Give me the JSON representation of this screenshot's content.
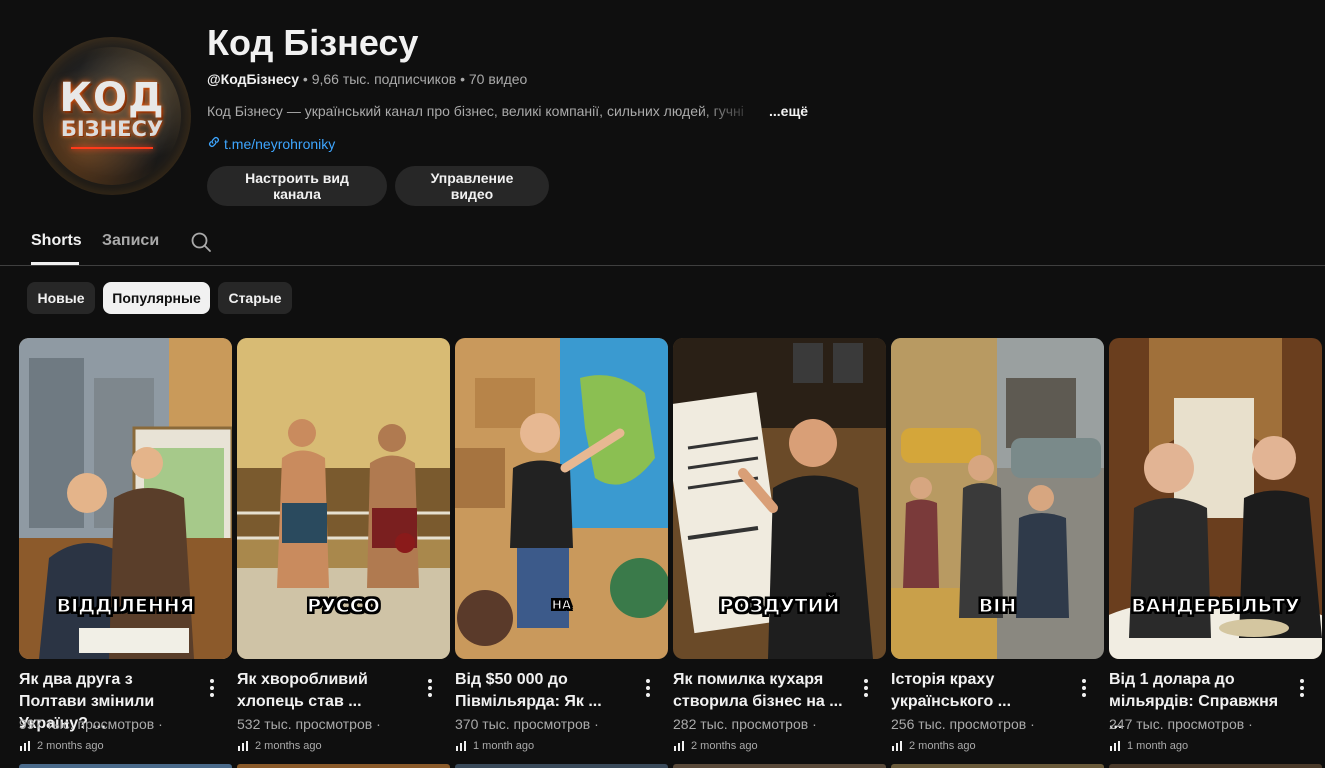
{
  "channel": {
    "name": "Код Бізнесу",
    "handle": "@КодБізнесу",
    "subscribers": "9,66 тыс. подписчиков",
    "videos": "70 видео",
    "description": "Код Бізнесу — український канал про бізнес, великі компанії, сильних людей, гучні",
    "more_label": "...ещё",
    "link": "t.me/neyrohroniky",
    "avatar_logo_line1": "КОД",
    "avatar_logo_line2": "БІЗНЕСУ",
    "buttons": {
      "customize": "Настроить вид канала",
      "manage": "Управление видео"
    }
  },
  "tabs": [
    {
      "label": "Shorts",
      "active": true
    },
    {
      "label": "Записи",
      "active": false
    }
  ],
  "chips": [
    {
      "label": "Новые",
      "selected": false
    },
    {
      "label": "Популярные",
      "selected": true
    },
    {
      "label": "Старые",
      "selected": false
    }
  ],
  "shorts": [
    {
      "title": "Як два друга з Полтави змінили Україну? ...",
      "caption": "ВІДДІЛЕННЯ",
      "views": "997 тыс. просмотров ·",
      "date": "2 months ago"
    },
    {
      "title": "Як хворобливий хлопець став ...",
      "caption": "РУССО",
      "views": "532 тыс. просмотров ·",
      "date": "2 months ago"
    },
    {
      "title": "Від $50 000 до Півмільярда: Як ...",
      "caption": "НА",
      "views": "370 тыс. просмотров ·",
      "date": "1 month ago"
    },
    {
      "title": "Як помилка кухаря створила бізнес на ...",
      "caption": "РОЗДУТИЙ",
      "views": "282 тыс. просмотров ·",
      "date": "2 months ago"
    },
    {
      "title": "Історія краху українського ...",
      "caption": "ВІН",
      "views": "256 тыс. просмотров ·",
      "date": "2 months ago"
    },
    {
      "title": "Від 1 долара до мільярдів: Справжня ...",
      "caption": "ВАНДЕРБІЛЬТУ",
      "views": "247 тыс. просмотров ·",
      "date": "1 month ago"
    }
  ],
  "colors": {
    "background": "#0f0f0f",
    "chip": "#272727",
    "link": "#3ea6ff",
    "muted": "#aaaaaa"
  },
  "icons": [
    "link-icon",
    "search-icon",
    "more-vert-icon",
    "stats-icon"
  ]
}
